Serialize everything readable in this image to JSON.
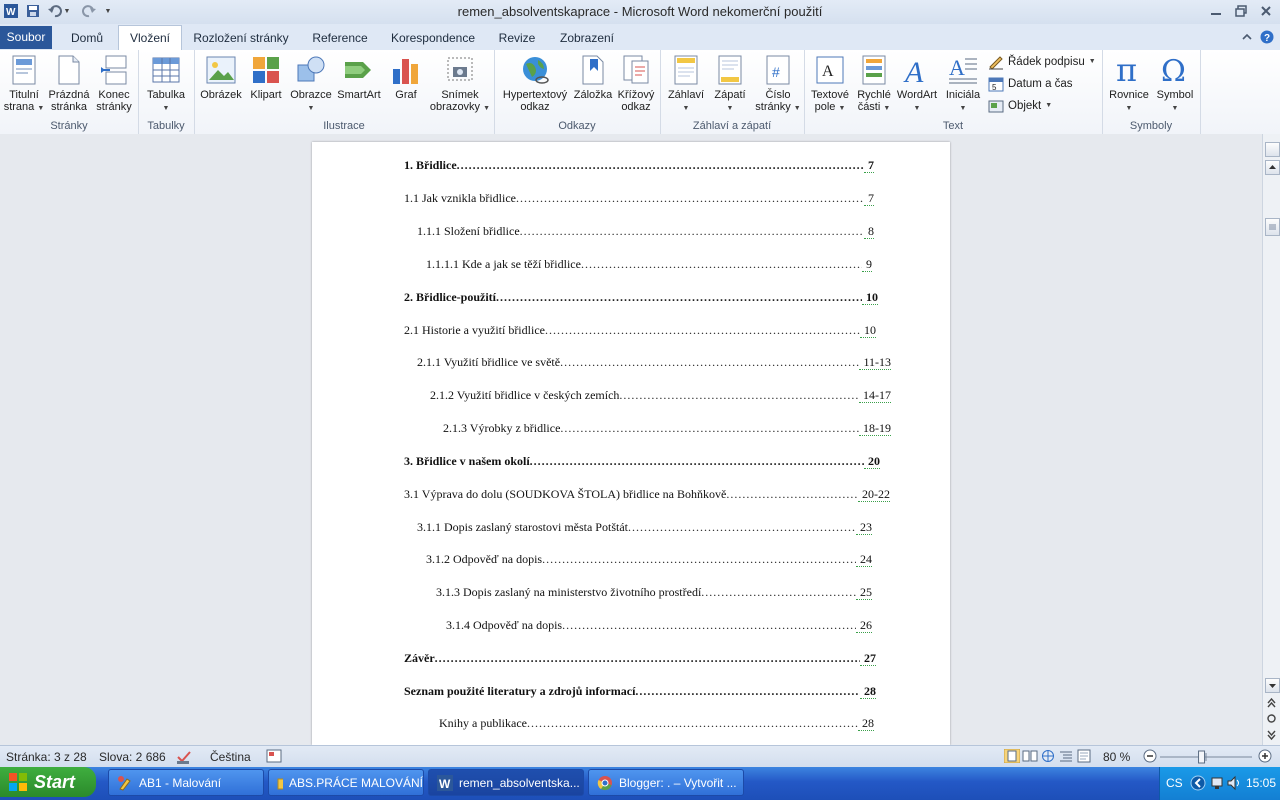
{
  "titlebar": {
    "title": "remen_absolventskaprace  -  Microsoft Word nekomerční použití"
  },
  "tabs": [
    {
      "label": "Soubor"
    },
    {
      "label": "Domů"
    },
    {
      "label": "Vložení"
    },
    {
      "label": "Rozložení stránky"
    },
    {
      "label": "Reference"
    },
    {
      "label": "Korespondence"
    },
    {
      "label": "Revize"
    },
    {
      "label": "Zobrazení"
    }
  ],
  "ribbon": {
    "groups": {
      "pages": "Stránky",
      "tables": "Tabulky",
      "illustrations": "Ilustrace",
      "links": "Odkazy",
      "header_footer": "Záhlaví a zápatí",
      "text": "Text",
      "symbols": "Symboly"
    },
    "buttons": {
      "cover_1": "Titulní",
      "cover_2": "strana",
      "blank_1": "Prázdná",
      "blank_2": "stránka",
      "break_1": "Konec",
      "break_2": "stránky",
      "table": "Tabulka",
      "picture": "Obrázek",
      "clipart": "Klipart",
      "shapes": "Obrazce",
      "smartart": "SmartArt",
      "chart": "Graf",
      "screenshot_1": "Snímek",
      "screenshot_2": "obrazovky",
      "hyperlink_1": "Hypertextový",
      "hyperlink_2": "odkaz",
      "bookmark": "Záložka",
      "crossref_1": "Křížový",
      "crossref_2": "odkaz",
      "header": "Záhlaví",
      "footer": "Zápatí",
      "pagenum_1": "Číslo",
      "pagenum_2": "stránky",
      "textbox_1": "Textové",
      "textbox_2": "pole",
      "quickparts_1": "Rychlé",
      "quickparts_2": "části",
      "wordart": "WordArt",
      "dropcap": "Iniciála",
      "signature": "Řádek podpisu",
      "datetime": "Datum a čas",
      "object": "Objekt",
      "equation": "Rovnice",
      "symbol": "Symbol"
    }
  },
  "toc": [
    {
      "title": "1. Břidlice",
      "page": "7",
      "bold": true
    },
    {
      "title": "1.1 Jak vznikla břidlice",
      "page": "7",
      "bold": false
    },
    {
      "title": "1.1.1 Složení břidlice",
      "page": "8",
      "bold": false
    },
    {
      "title": "1.1.1.1 Kde a jak se těží břidlice",
      "page": "9",
      "bold": false
    },
    {
      "title": "2. Břidlice-použití",
      "page": "10",
      "bold": true
    },
    {
      "title": "2.1 Historie a využití břidlice",
      "page": "10",
      "bold": false
    },
    {
      "title": "2.1.1 Využití břidlice ve světě",
      "page": "11-13",
      "bold": false
    },
    {
      "title": "2.1.2 Využití břidlice v českých zemích",
      "page": "14-17",
      "bold": false
    },
    {
      "title": "2.1.3 Výrobky z břidlice",
      "page": "18-19",
      "bold": false
    },
    {
      "title": "3. Břidlice v našem okolí",
      "page": "20",
      "bold": true
    },
    {
      "title": "3.1 Výprava do dolu (SOUDKOVA ŠTOLA) břidlice na Bohňkově",
      "page": "20-22",
      "bold": false
    },
    {
      "title": "3.1.1 Dopis zaslaný starostovi města Potštát",
      "page": "23",
      "bold": false
    },
    {
      "title": "3.1.2 Odpověď na dopis",
      "page": "24",
      "bold": false
    },
    {
      "title": "3.1.3 Dopis zaslaný na ministerstvo životního prostředí",
      "page": "25",
      "bold": false
    },
    {
      "title": "3.1.4 Odpověď na dopis",
      "page": "26",
      "bold": false
    },
    {
      "title": "Závěr",
      "page": "27",
      "bold": true
    },
    {
      "title": "Seznam použité literatury a zdrojů informací",
      "page": "28",
      "bold": true
    },
    {
      "title": "Knihy a publikace",
      "page": "28",
      "bold": false
    }
  ],
  "statusbar": {
    "page": "Stránka: 3 z 28",
    "words": "Slova: 2 686",
    "language": "Čeština",
    "zoom": "80 %",
    "zoom_level": 0.8
  },
  "taskbar": {
    "start": "Start",
    "tasks": [
      {
        "label": "AB1 - Malování"
      },
      {
        "label": "ABS.PRÁCE MALOVÁNÍ"
      },
      {
        "label": "remen_absolventska..."
      },
      {
        "label": "Blogger: . – Vytvořit ..."
      }
    ],
    "lang": "CS",
    "time": "15:05"
  },
  "colors": {
    "file_tab": "#2b579a",
    "taskbar": "#2458c6",
    "start": "#2b8a2b"
  }
}
